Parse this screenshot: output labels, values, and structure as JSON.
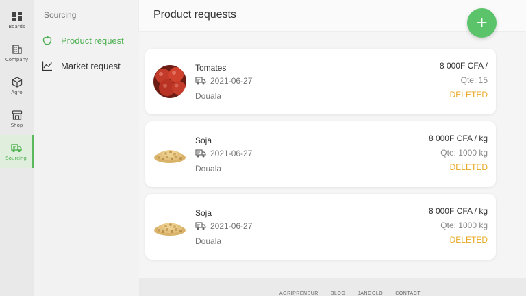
{
  "rail": {
    "items": [
      {
        "label": "Boards",
        "icon": "boards-icon"
      },
      {
        "label": "Company",
        "icon": "company-icon"
      },
      {
        "label": "Agro",
        "icon": "cube-icon"
      },
      {
        "label": "Shop",
        "icon": "shop-icon"
      },
      {
        "label": "Sourcing",
        "icon": "truck-icon",
        "active": true
      }
    ]
  },
  "subnav": {
    "heading": "Sourcing",
    "items": [
      {
        "label": "Product request",
        "icon": "apple-icon",
        "active": true
      },
      {
        "label": "Market request",
        "icon": "line-chart-icon"
      }
    ]
  },
  "main": {
    "title": "Product requests",
    "fab_label": "+",
    "requests": [
      {
        "name": "Tomates",
        "date": "2021-06-27",
        "city": "Douala",
        "price": "8 000F CFA /",
        "qty": "Qte: 15",
        "status": "DELETED",
        "image": "tomato"
      },
      {
        "name": "Soja",
        "date": "2021-06-27",
        "city": "Douala",
        "price": "8 000F CFA / kg",
        "qty": "Qte: 1000 kg",
        "status": "DELETED",
        "image": "soy"
      },
      {
        "name": "Soja",
        "date": "2021-06-27",
        "city": "Douala",
        "price": "8 000F CFA / kg",
        "qty": "Qte: 1000 kg",
        "status": "DELETED",
        "image": "soy"
      }
    ]
  },
  "footer": {
    "links": [
      "AGRIPRENEUR",
      "BLOG",
      "JANGOLO",
      "CONTACT"
    ]
  },
  "colors": {
    "accent": "#4caf50",
    "fab": "#5bc46a",
    "status_deleted": "#e8a822"
  }
}
